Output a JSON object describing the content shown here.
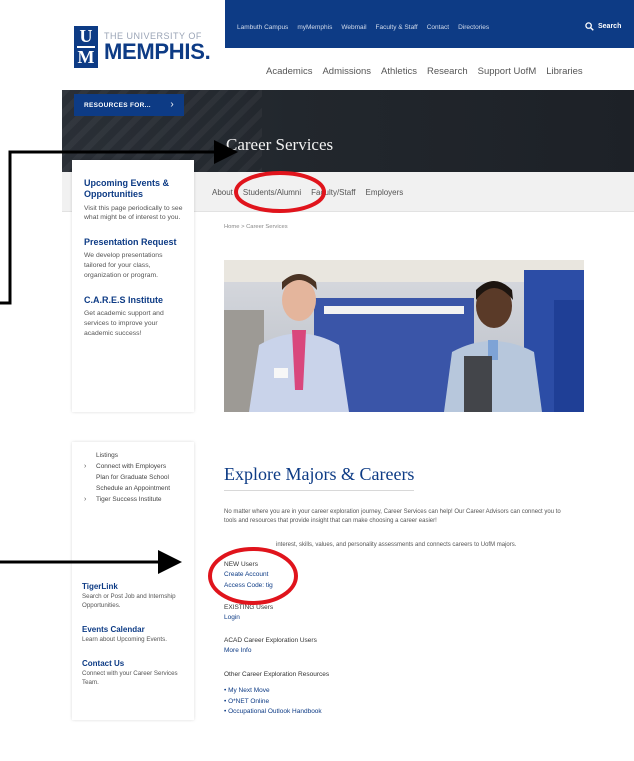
{
  "utility_bar": {
    "links": [
      "Lambuth Campus",
      "myMemphis",
      "Webmail",
      "Faculty & Staff",
      "Contact",
      "Directories"
    ],
    "search_label": "Search"
  },
  "logo": {
    "university_line": "THE UNIVERSITY OF",
    "name": "MEMPHIS."
  },
  "main_nav": [
    "Academics",
    "Admissions",
    "Athletics",
    "Research",
    "Support UofM",
    "Libraries"
  ],
  "banner": {
    "resources_label": "RESOURCES FOR...",
    "title": "Career Services"
  },
  "subnav": [
    "About",
    "Students/Alumni",
    "Faculty/Staff",
    "Employers"
  ],
  "breadcrumb": "Home > Career Services",
  "sidebar_top": [
    {
      "title": "Upcoming Events & Opportunities",
      "desc": "Visit this page periodically to see what might be of interest to you."
    },
    {
      "title": "Presentation Request",
      "desc": "We develop presentations tailored for your class, organization or program."
    },
    {
      "title": "C.A.R.E.S Institute",
      "desc": "Get academic support and services to improve your academic success!"
    }
  ],
  "sidebar_menu": [
    {
      "label": "Listings",
      "caret": false
    },
    {
      "label": "Connect with Employers",
      "caret": true
    },
    {
      "label": "Plan for Graduate School",
      "caret": false
    },
    {
      "label": "Schedule an Appointment",
      "caret": false
    },
    {
      "label": "Tiger Success Institute",
      "caret": true
    }
  ],
  "sidebar_links": [
    {
      "title": "TigerLink",
      "desc": "Search or Post Job and Internship Opportunities."
    },
    {
      "title": "Events Calendar",
      "desc": "Learn about Upcoming Events."
    },
    {
      "title": "Contact Us",
      "desc": "Connect with your Career Services Team."
    }
  ],
  "explore": {
    "title": "Explore Majors & Careers",
    "intro": "No matter where you are in your career exploration journey, Career Services can help! Our Career Advisors can connect you to tools and resources that provide insight that can make choosing a career easier!",
    "focus_text": "interest, skills, values, and personality assessments and connects careers to UofM majors.",
    "new_users": {
      "label": "NEW Users",
      "links": [
        "Create Account",
        "Access Code: tig"
      ]
    },
    "existing_users": {
      "label": "EXISTING Users",
      "links": [
        "Login"
      ]
    },
    "acad_users": {
      "label": "ACAD Career Exploration Users",
      "links": [
        "More Info"
      ]
    },
    "other": {
      "label": "Other Career Exploration Resources",
      "links": [
        "• My Next Move",
        "• O*NET Online",
        "• Occupational Outlook Handbook"
      ]
    }
  },
  "colors": {
    "brand_blue": "#0d3b85",
    "annotation_red": "#e0141c",
    "banner_dark": "#23282e"
  }
}
